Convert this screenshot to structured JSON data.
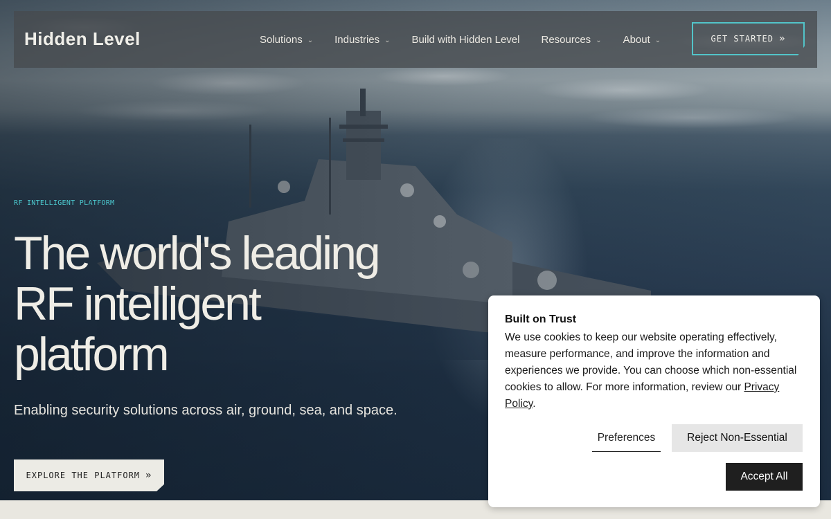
{
  "nav": {
    "logo": "Hidden Level",
    "items": [
      {
        "label": "Solutions",
        "has_dropdown": true
      },
      {
        "label": "Industries",
        "has_dropdown": true
      },
      {
        "label": "Build with Hidden Level",
        "has_dropdown": false
      },
      {
        "label": "Resources",
        "has_dropdown": true
      },
      {
        "label": "About",
        "has_dropdown": true
      }
    ],
    "cta_label": "GET STARTED",
    "cta_icon": "double-chevron-right-icon"
  },
  "hero": {
    "eyebrow": "RF INTELLIGENT PLATFORM",
    "headline_line1": "The world's leading",
    "headline_line2": "RF intelligent",
    "headline_line3": "platform",
    "subtext": "Enabling security solutions across air, ground, sea, and space.",
    "button_label": "EXPLORE THE PLATFORM",
    "button_icon": "double-chevron-right-icon"
  },
  "cookie": {
    "title": "Built on Trust",
    "body": "We use cookies to keep our website operating effectively, measure performance, and improve the information and experiences we provide. You can choose which non-essential cookies to allow. For more information, review our",
    "link_label": "Privacy Policy",
    "body_end": ".",
    "preferences_label": "Preferences",
    "reject_label": "Reject Non-Essential",
    "accept_label": "Accept All"
  },
  "colors": {
    "accent": "#52c4c9",
    "nav_bg": "#464a4e",
    "page_bg": "#e9e7e0"
  }
}
